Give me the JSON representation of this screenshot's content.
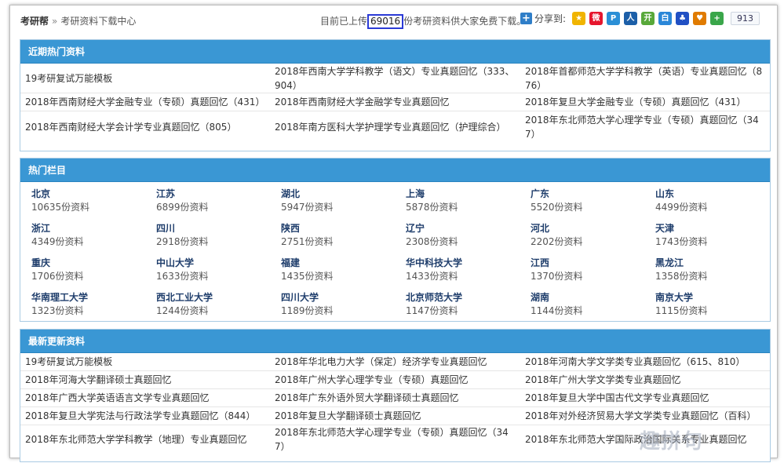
{
  "breadcrumb": {
    "home": "考研帮",
    "separator": "»",
    "current": "考研资料下载中心"
  },
  "notice": {
    "prefix": "目前已上传",
    "count": "69016",
    "suffix": "份考研资料供大家免费下载。"
  },
  "share": {
    "label": "分享到:",
    "count": "913",
    "icons": [
      {
        "name": "qzone-icon",
        "color": "#f0b400",
        "glyph": "★"
      },
      {
        "name": "weibo-icon",
        "color": "#e6162d",
        "glyph": "微"
      },
      {
        "name": "pengyou-icon",
        "color": "#2b8fd6",
        "glyph": "P"
      },
      {
        "name": "renren-icon",
        "color": "#1c5fa8",
        "glyph": "人"
      },
      {
        "name": "kaixin-icon",
        "color": "#58a83a",
        "glyph": "开"
      },
      {
        "name": "baidu-bai-icon",
        "color": "#2a87d8",
        "glyph": "白"
      },
      {
        "name": "baidu-paw-icon",
        "color": "#2150c4",
        "glyph": "♣"
      },
      {
        "name": "favorite-icon",
        "color": "#e07b00",
        "glyph": "♥"
      },
      {
        "name": "more-icon",
        "color": "#3aa64a",
        "glyph": "+"
      }
    ]
  },
  "recent_hot": {
    "title": "近期热门资料",
    "rows": [
      [
        "19考研复试万能模板",
        "2018年西南大学学科教学（语文）专业真题回忆（333、904）",
        "2018年首都师范大学学科教学（英语）专业真题回忆（876）"
      ],
      [
        "2018年西南财经大学金融专业（专硕）真题回忆（431）",
        "2018年西南财经大学金融学专业真题回忆",
        "2018年复旦大学金融专业（专硕）真题回忆（431）"
      ],
      [
        "2018年西南财经大学会计学专业真题回忆（805）",
        "2018年南方医科大学护理学专业真题回忆（护理综合）",
        "2018年东北师范大学心理学专业（专硕）真题回忆（347）"
      ]
    ]
  },
  "hot_columns": {
    "title": "热门栏目",
    "items": [
      {
        "name": "北京",
        "count": "10635份资料"
      },
      {
        "name": "江苏",
        "count": "6899份资料"
      },
      {
        "name": "湖北",
        "count": "5947份资料"
      },
      {
        "name": "上海",
        "count": "5878份资料"
      },
      {
        "name": "广东",
        "count": "5520份资料"
      },
      {
        "name": "山东",
        "count": "4499份资料"
      },
      {
        "name": "浙江",
        "count": "4349份资料"
      },
      {
        "name": "四川",
        "count": "2918份资料"
      },
      {
        "name": "陕西",
        "count": "2751份资料"
      },
      {
        "name": "辽宁",
        "count": "2308份资料"
      },
      {
        "name": "河北",
        "count": "2202份资料"
      },
      {
        "name": "天津",
        "count": "1743份资料"
      },
      {
        "name": "重庆",
        "count": "1706份资料"
      },
      {
        "name": "中山大学",
        "count": "1633份资料"
      },
      {
        "name": "福建",
        "count": "1435份资料"
      },
      {
        "name": "华中科技大学",
        "count": "1433份资料"
      },
      {
        "name": "江西",
        "count": "1370份资料"
      },
      {
        "name": "黑龙江",
        "count": "1358份资料"
      },
      {
        "name": "华南理工大学",
        "count": "1323份资料"
      },
      {
        "name": "西北工业大学",
        "count": "1244份资料"
      },
      {
        "name": "四川大学",
        "count": "1189份资料"
      },
      {
        "name": "北京师范大学",
        "count": "1147份资料"
      },
      {
        "name": "湖南",
        "count": "1144份资料"
      },
      {
        "name": "南京大学",
        "count": "1115份资料"
      }
    ]
  },
  "latest": {
    "title": "最新更新资料",
    "rows": [
      [
        "19考研复试万能模板",
        "2018年华北电力大学（保定）经济学专业真题回忆",
        "2018年河南大学文学类专业真题回忆（615、810）"
      ],
      [
        "2018年河海大学翻译硕士真题回忆",
        "2018年广州大学心理学专业（专硕）真题回忆",
        "2018年广州大学文学类专业真题回忆"
      ],
      [
        "2018年广西大学英语语言文学专业真题回忆",
        "2018年广东外语外贸大学翻译硕士真题回忆",
        "2018年复旦大学中国古代文学专业真题回忆"
      ],
      [
        "2018年复旦大学宪法与行政法学专业真题回忆（844）",
        "2018年复旦大学翻译硕士真题回忆",
        "2018年对外经济贸易大学文学类专业真题回忆（百科）"
      ],
      [
        "2018年东北师范大学学科教学（地理）专业真题回忆",
        "2018年东北师范大学心理学专业（专硕）真题回忆（347）",
        "2018年东北师范大学国际政治国际关系专业真题回忆"
      ]
    ]
  },
  "watermark": "趣拼句"
}
